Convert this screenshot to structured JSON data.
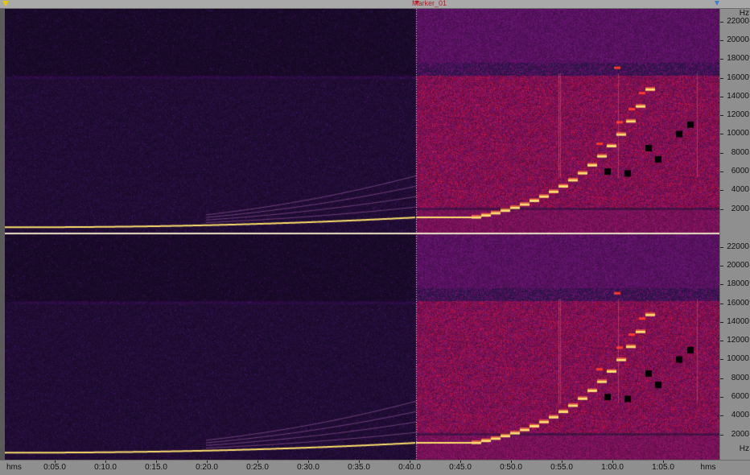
{
  "window": {
    "marker_label": "Marker_01"
  },
  "freq_axis": {
    "unit": "Hz",
    "ticks": [
      "22000",
      "20000",
      "18000",
      "16000",
      "14000",
      "12000",
      "10000",
      "8000",
      "6000",
      "4000",
      "2000"
    ]
  },
  "time_axis": {
    "unit": "hms",
    "ticks": [
      "0:05.0",
      "0:10.0",
      "0:15.0",
      "0:20.0",
      "0:25.0",
      "0:30.0",
      "0:35.0",
      "0:40.0",
      "0:45.0",
      "0:50.0",
      "0:55.0",
      "1:00.0",
      "1:05.0"
    ]
  },
  "colors": {
    "background_quiet": "#2a1245",
    "background_loud": "#8a1a78",
    "band_red": "#c01848",
    "tone_hot": "#ffe070",
    "separator": "#f2e6c8",
    "marker": "#c0202a",
    "start_marker": "#e8c800",
    "end_marker": "#3b7fd0"
  },
  "view": {
    "type": "spectrogram",
    "channels": 2,
    "marker_time": "0:40.5"
  }
}
